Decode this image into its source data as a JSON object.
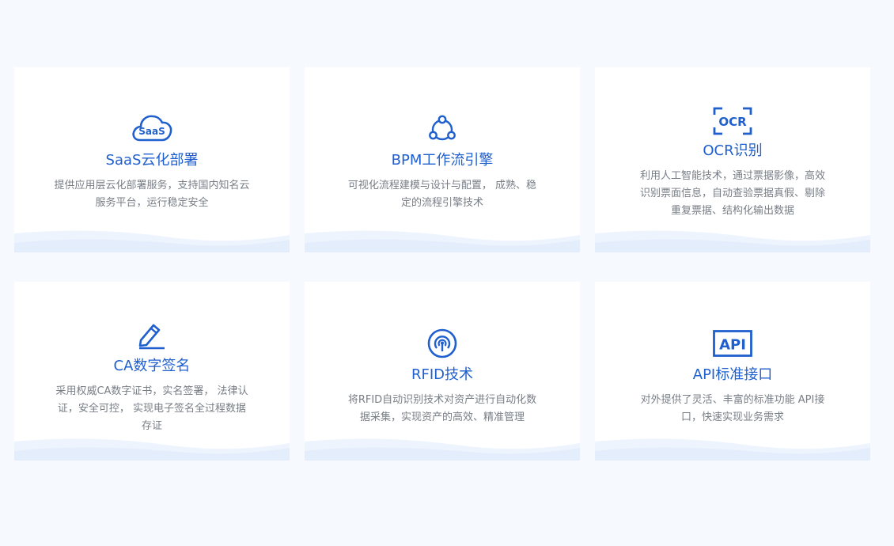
{
  "colors": {
    "page_background": "#f6f9fe",
    "card_background": "#ffffff",
    "accent": "#1f5fce",
    "description_text": "#787e86",
    "wave": "#e7effc"
  },
  "cards": [
    {
      "icon": "saas-cloud-icon",
      "icon_text": "SaaS",
      "title": "SaaS云化部署",
      "description": "提供应用层云化部署服务，支持国内知名云服务平台，运行稳定安全"
    },
    {
      "icon": "bpm-workflow-icon",
      "title": "BPM工作流引擎",
      "description": "可视化流程建模与设计与配置， 成熟、稳定的流程引擎技术"
    },
    {
      "icon": "ocr-scan-icon",
      "icon_text": "OCR",
      "title": "OCR识别",
      "description": "利用人工智能技术，通过票据影像，高效识别票面信息，自动查验票据真假、剔除重复票据、结构化输出数据"
    },
    {
      "icon": "pen-signature-icon",
      "title": "CA数字签名",
      "description": "采用权威CA数字证书，实名签署， 法律认证，安全可控， 实现电子签名全过程数据存证"
    },
    {
      "icon": "rfid-signal-icon",
      "title": "RFID技术",
      "description": "将RFID自动识别技术对资产进行自动化数据采集，实现资产的高效、精准管理"
    },
    {
      "icon": "api-box-icon",
      "icon_text": "API",
      "title": "API标准接口",
      "description": "对外提供了灵活、丰富的标准功能 API接口，快速实现业务需求"
    }
  ]
}
